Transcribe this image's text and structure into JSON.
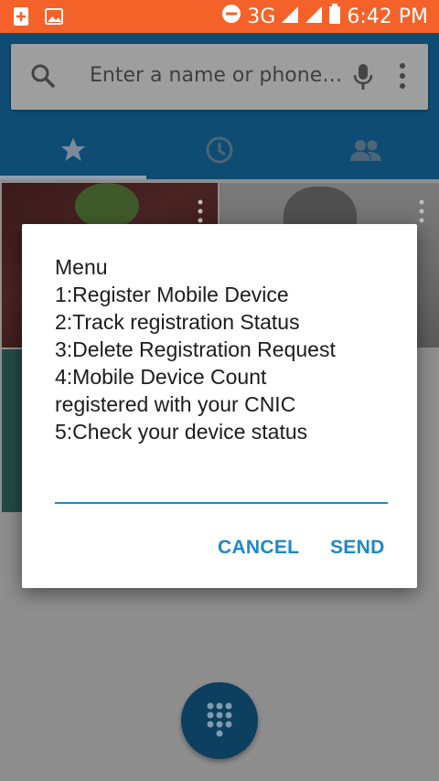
{
  "status_bar": {
    "network": "3G",
    "time": "6:42 PM",
    "icons": [
      "sim-add-icon",
      "image-icon",
      "do-not-disturb-icon",
      "signal-icon",
      "signal-icon",
      "battery-icon"
    ]
  },
  "search": {
    "placeholder": "Enter a name or phone…",
    "icons": [
      "search-icon",
      "mic-icon",
      "more-vert-icon"
    ]
  },
  "tabs": [
    {
      "name": "favorites",
      "icon": "star-icon",
      "selected": true
    },
    {
      "name": "recents",
      "icon": "clock-icon",
      "selected": false
    },
    {
      "name": "contacts",
      "icon": "people-icon",
      "selected": false
    }
  ],
  "dialog": {
    "message_lines": [
      "Menu",
      "1:Register Mobile Device",
      "2:Track registration Status",
      "3:Delete Registration Request",
      "4:Mobile Device Count",
      "registered with your CNIC",
      "5:Check your device status"
    ],
    "input_value": "",
    "cancel_label": "CANCEL",
    "send_label": "SEND"
  },
  "fab": {
    "icon": "dialpad-icon"
  },
  "colors": {
    "status_bar": "#f4622a",
    "app_bar": "#0e4c73",
    "accent": "#1e88c7"
  }
}
